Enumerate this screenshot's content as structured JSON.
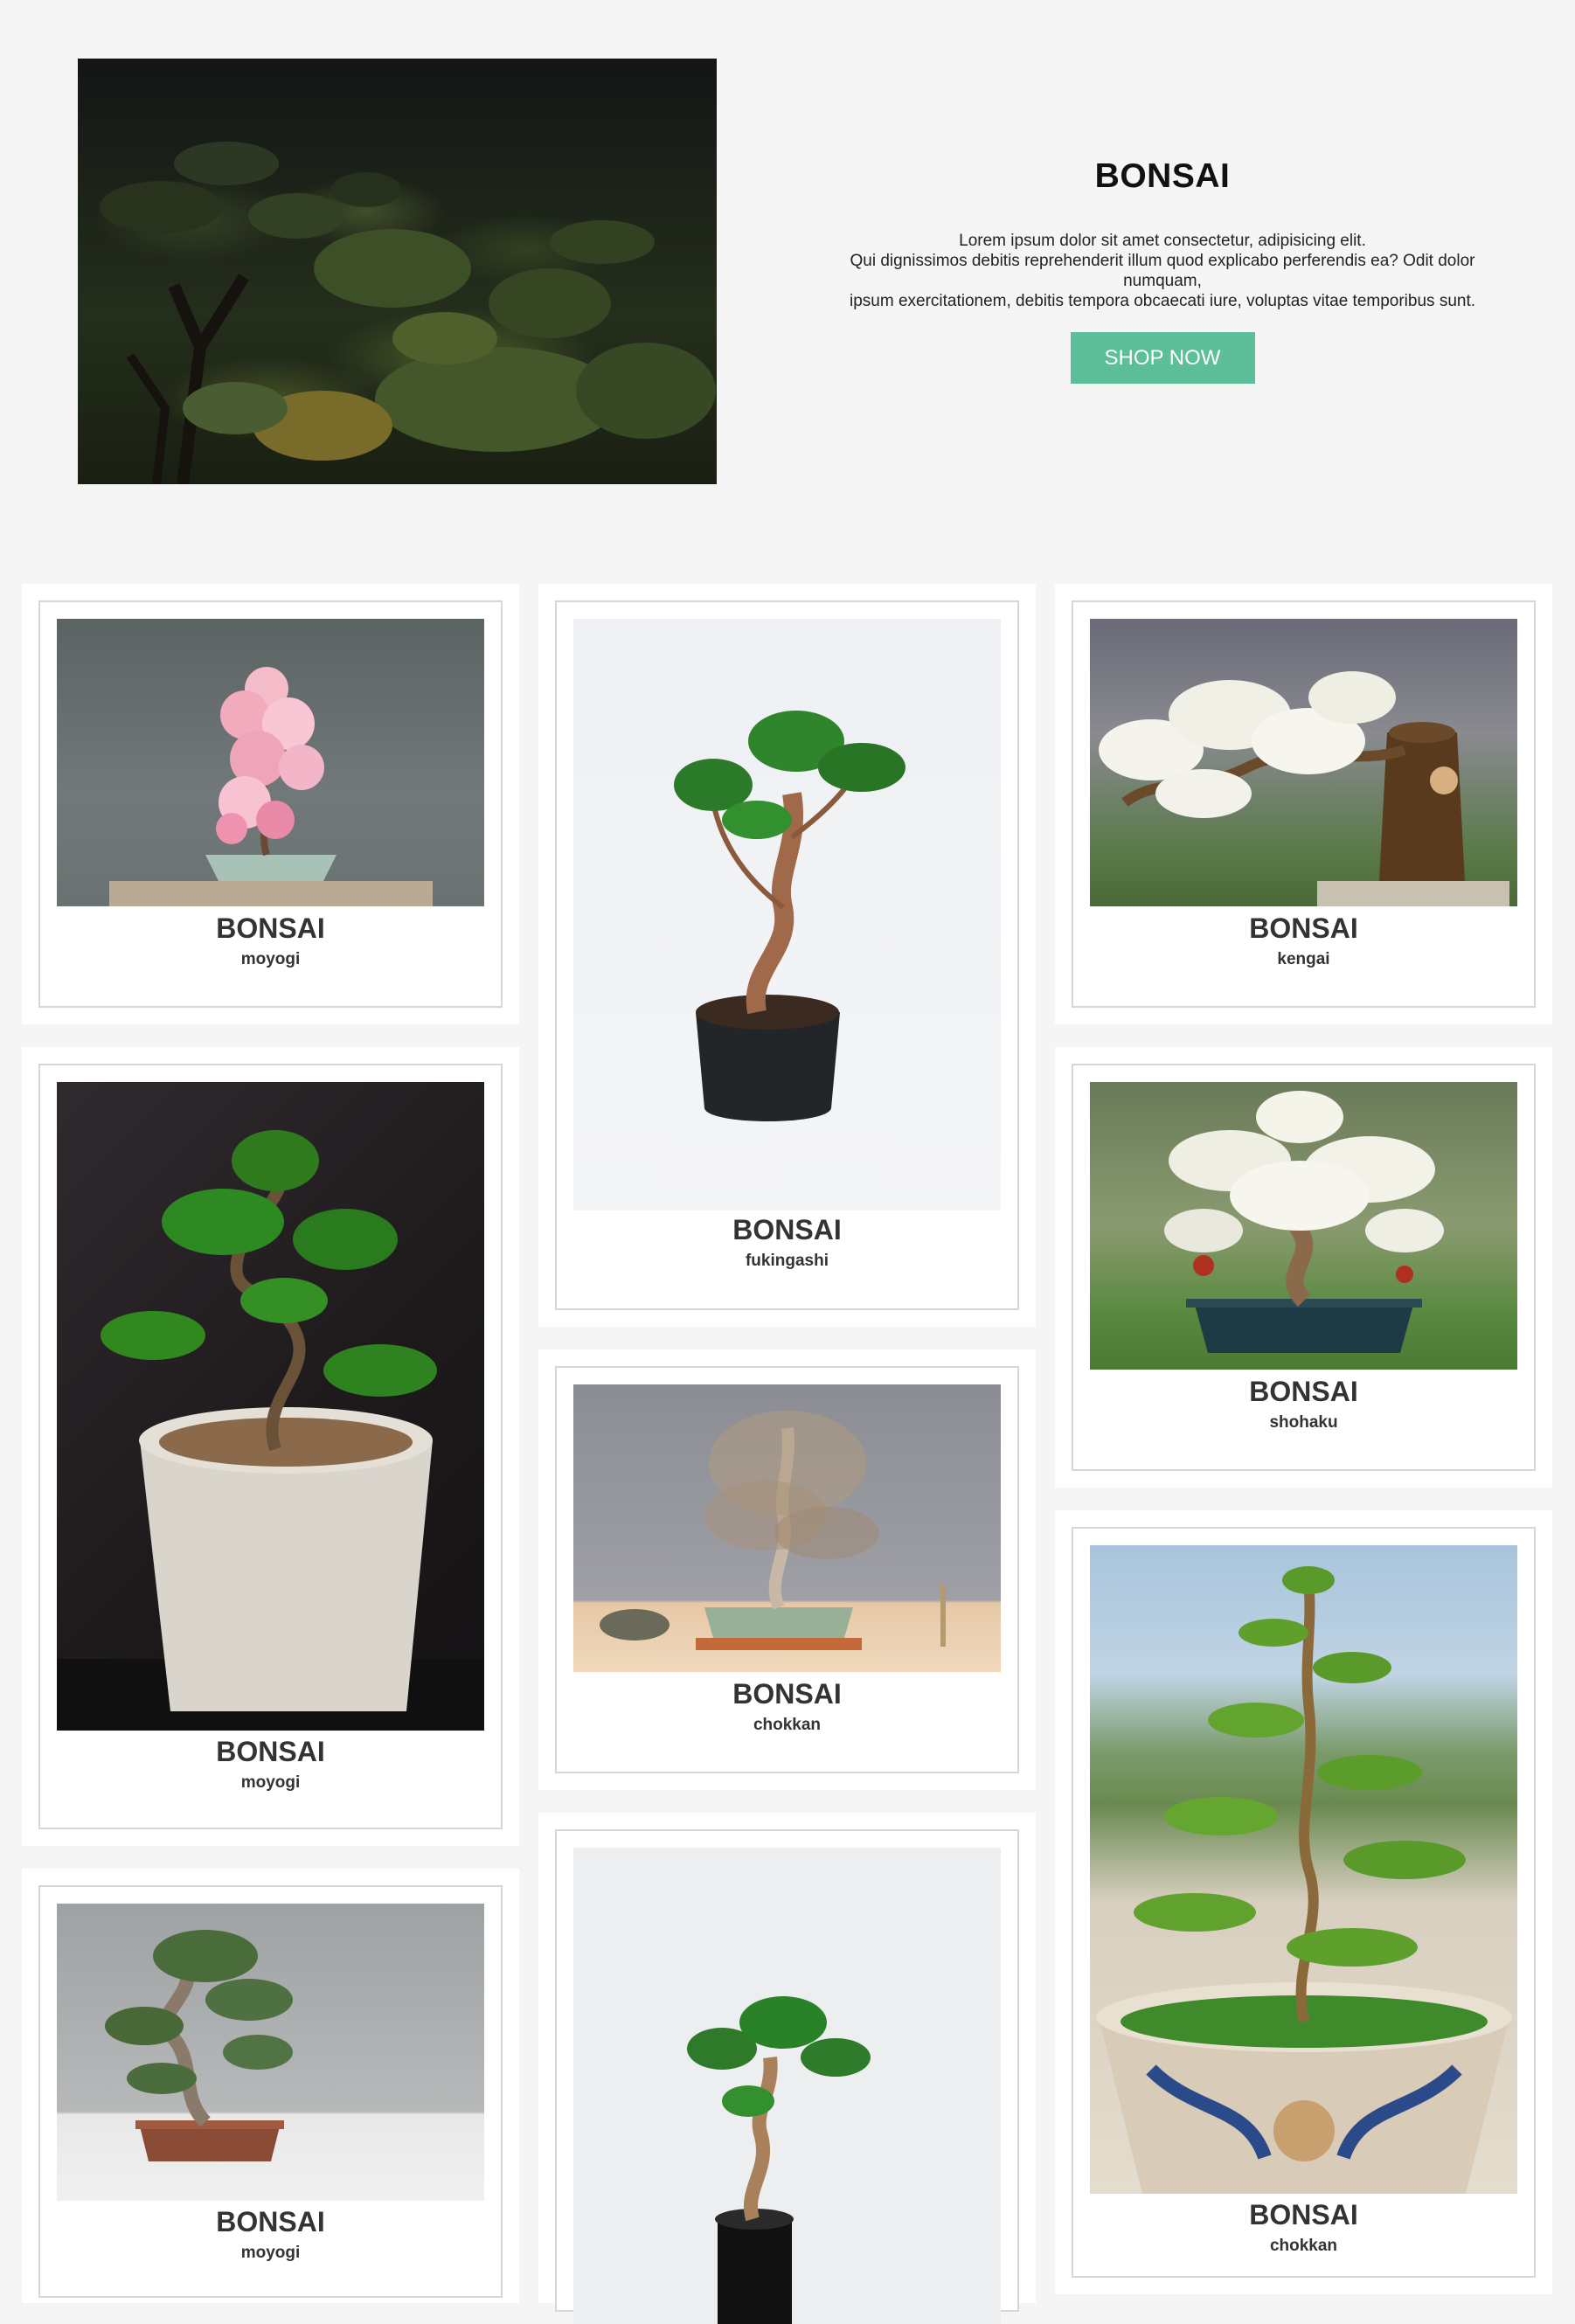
{
  "hero": {
    "title": "BONSAI",
    "description_line1": "Lorem ipsum dolor sit amet consectetur, adipisicing elit.",
    "description_line2": "Qui dignissimos debitis reprehenderit illum quod explicabo perferendis ea? Odit dolor numquam,",
    "description_line3": "ipsum exercitationem, debitis tempora obcaecati iure, voluptas vitae temporibus sunt.",
    "button_label": "SHOP NOW",
    "button_color": "#5cbf99"
  },
  "gallery": {
    "column_1": [
      {
        "title": "BONSAI",
        "style": "moyogi"
      },
      {
        "title": "BONSAI",
        "style": "moyogi"
      },
      {
        "title": "BONSAI",
        "style": "moyogi"
      }
    ],
    "column_2": [
      {
        "title": "BONSAI",
        "style": "fukingashi"
      },
      {
        "title": "BONSAI",
        "style": "chokkan"
      }
    ],
    "column_3": [
      {
        "title": "BONSAI",
        "style": "kengai"
      },
      {
        "title": "BONSAI",
        "style": "shohaku"
      },
      {
        "title": "BONSAI",
        "style": "chokkan"
      }
    ]
  }
}
